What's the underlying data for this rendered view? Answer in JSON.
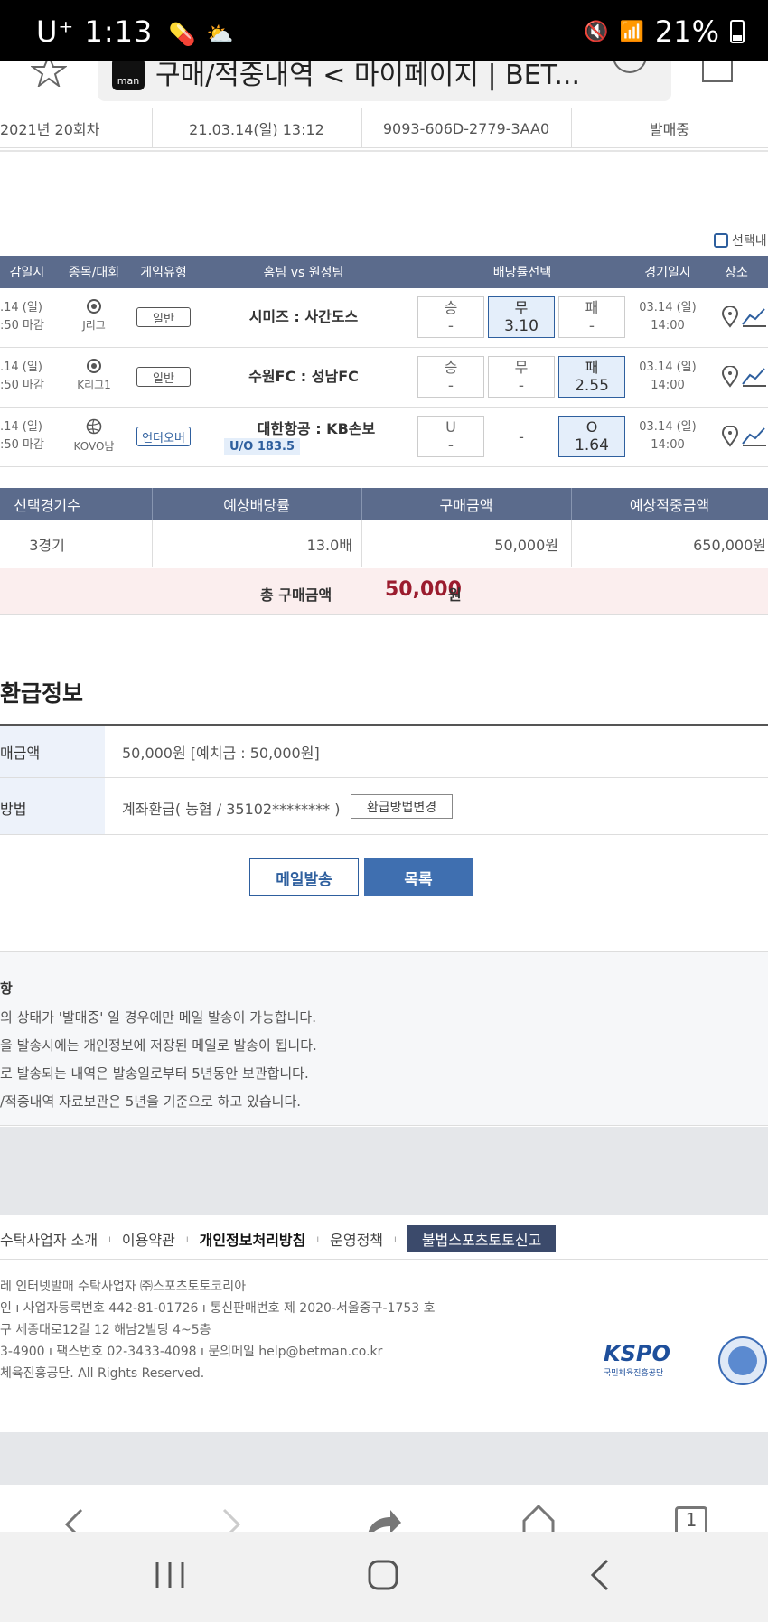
{
  "status_bar": {
    "carrier": "U⁺",
    "time": "1:13",
    "battery": "21%"
  },
  "browser": {
    "tab_title": "구매/적중내역 < 마이페이지 | BET..."
  },
  "purchase_row": {
    "round": "2021년 20회차",
    "datetime": "21.03.14(일) 13:12",
    "ticket_id": "9093-606D-2779-3AA0",
    "status": "발매중"
  },
  "select_all_label": "선택내",
  "game_table": {
    "headers": [
      "감일시",
      "종목/대회",
      "게임유형",
      "홈팀 vs 원정팀",
      "배당률선택",
      "경기일시",
      "장소"
    ],
    "rows": [
      {
        "deadline_date": ".14 (일)",
        "deadline_time": ":50 마감",
        "league": "J리그",
        "type": "일반",
        "match": "시미즈 : 사간도스",
        "sub": "",
        "o1_label": "승",
        "o1_val": "-",
        "o2_label": "무",
        "o2_val": "3.10",
        "o3_label": "패",
        "o3_val": "-",
        "sel": 2,
        "game_date": "03.14 (일)",
        "game_time": "14:00"
      },
      {
        "deadline_date": ".14 (일)",
        "deadline_time": ":50 마감",
        "league": "K리그1",
        "type": "일반",
        "match": "수원FC : 성남FC",
        "sub": "",
        "o1_label": "승",
        "o1_val": "-",
        "o2_label": "무",
        "o2_val": "-",
        "o3_label": "패",
        "o3_val": "2.55",
        "sel": 3,
        "game_date": "03.14 (일)",
        "game_time": "14:00"
      },
      {
        "deadline_date": ".14 (일)",
        "deadline_time": ":50 마감",
        "league": "KOVO남",
        "type": "언더오버",
        "match": "대한항공 : KB손보",
        "sub": "U/O 183.5",
        "o1_label": "U",
        "o1_val": "-",
        "o2_label": "-",
        "o2_val": "",
        "o3_label": "O",
        "o3_val": "1.64",
        "sel": 3,
        "game_date": "03.14 (일)",
        "game_time": "14:00"
      }
    ]
  },
  "summary": {
    "headers": [
      "선택경기수",
      "예상배당률",
      "구매금액",
      "예상적중금액"
    ],
    "values": [
      "3경기",
      "13.0배",
      "50,000원",
      "650,000원"
    ],
    "total_label": "총 구매금액",
    "total_amount": "50,000",
    "total_unit": "원"
  },
  "refund": {
    "title": "환급정보",
    "row1_label": "매금액",
    "row1_value": "50,000원 [예치금 : 50,000원]",
    "row2_label": "방법",
    "row2_value": "계좌환급( 농협 / 35102******** )",
    "change_button": "환급방법변경"
  },
  "buttons": {
    "mail": "메일발송",
    "list": "목록"
  },
  "notice": {
    "title": "항",
    "items": [
      "의 상태가 '발매중' 일 경우에만 메일 발송이 가능합니다.",
      "을 발송시에는 개인정보에 저장된 메일로 발송이 됩니다.",
      "로 발송되는 내역은 발송일로부터 5년동안 보관합니다.",
      "/적중내역 자료보관은 5년을 기준으로 하고 있습니다."
    ]
  },
  "footer": {
    "links": [
      "수탁사업자 소개",
      "이용약관",
      "개인정보처리방침",
      "운영정책"
    ],
    "report_button": "불법스포츠토토신고",
    "line1": "레 인터넷발매 수탁사업자 ㈜스포츠토토코리아",
    "line2": "인   ı   사업자등록번호 442-81-01726   ı   통신판매번호 제 2020-서울중구-1753 호",
    "line3": "구 세종대로12길 12 해남2빌딩 4~5층",
    "line4": "3-4900   ı   팩스번호 02-3433-4098   ı   문의메일 help@betman.co.kr",
    "line5": "체육진흥공단. All Rights Reserved.",
    "kspo_logo": "KSPO",
    "kspo_sub": "국민체육진흥공단"
  },
  "browser_nav": {
    "tab_count": "1"
  }
}
